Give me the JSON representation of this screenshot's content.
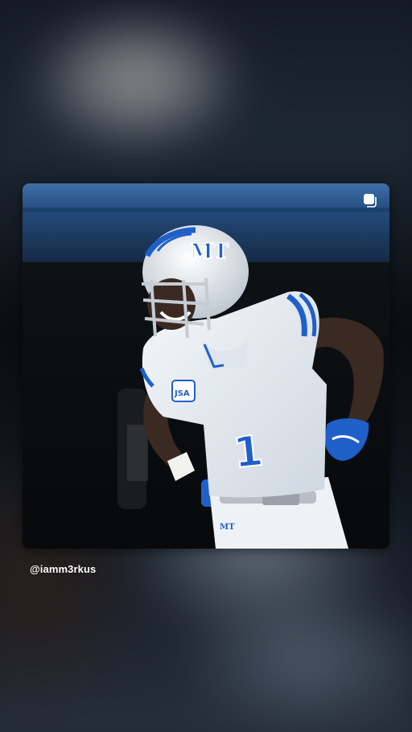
{
  "post": {
    "username": "@iamm3rkus",
    "photo_description_icon": "football-player-photo",
    "jersey_number": "1",
    "helmet_logo": "MT",
    "chest_patch": "JSA"
  },
  "icons": {
    "multi_media": "square-stack-icon"
  },
  "colors": {
    "uniform_blue": "#1f5fc9",
    "uniform_white": "#eef2f6",
    "canopy_blue": "#2a4f80"
  }
}
